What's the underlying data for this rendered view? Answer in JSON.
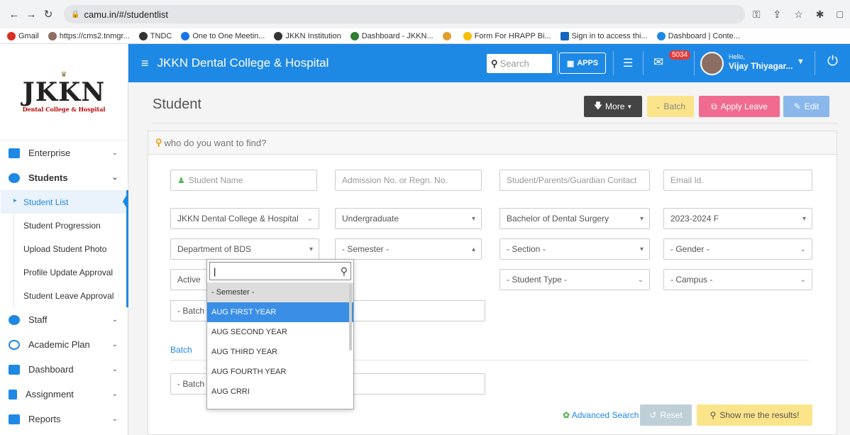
{
  "browser": {
    "url": "camu.in/#/studentlist",
    "bookmarks": [
      "Gmail",
      "https://cms2.tnmgr...",
      "TNDC",
      "One to One Meetin...",
      "JKKN Institution",
      "Dashboard - JKKN...",
      "Form For HRAPP Bi...",
      "Sign in to access thi...",
      "Dashboard | Conte..."
    ]
  },
  "logo": {
    "name": "JKKN",
    "sub": "Dental College & Hospital"
  },
  "sidebar": {
    "items": [
      {
        "label": "Enterprise",
        "color": "#1e88e5"
      },
      {
        "label": "Students",
        "color": "#1e88e5"
      },
      {
        "label": "Staff",
        "color": "#1e88e5"
      },
      {
        "label": "Academic Plan",
        "color": "#1e88e5"
      },
      {
        "label": "Dashboard",
        "color": "#1e88e5"
      },
      {
        "label": "Assignment",
        "color": "#1e88e5"
      },
      {
        "label": "Reports",
        "color": "#1e88e5"
      }
    ],
    "sub_items": [
      "Student List",
      "Student Progression",
      "Upload Student Photo",
      "Profile Update Approval",
      "Student Leave Approval"
    ]
  },
  "topbar": {
    "title": "JKKN Dental College & Hospital",
    "search_placeholder": "Search",
    "apps_label": "APPS",
    "mail_count": "5034",
    "hello": "Hello,",
    "user": "Vijay Thiyagar..."
  },
  "page": {
    "title": "Student",
    "more_label": "More",
    "batch_label": "Batch",
    "apply_leave_label": "Apply Leave",
    "edit_label": "Edit"
  },
  "search_panel": {
    "header": "who do you want to find?",
    "student_name": "Student Name",
    "admission": "Admission No. or Regn. No.",
    "contact": "Student/Parents/Guardian Contact",
    "email": "Email Id.",
    "institution": "JKKN Dental College & Hospital",
    "level": "Undergraduate",
    "program": "Bachelor of Dental Surgery",
    "academic_year": "2023-2024 F",
    "department": "Department of BDS",
    "semester": "- Semester -",
    "section": "- Section -",
    "gender": "- Gender -",
    "status": "Active",
    "student_type": "- Student Type -",
    "campus": "- Campus -",
    "batch_year": "- Batch Year -",
    "batch_section_label": "Batch",
    "batch_type": "- Batch type -",
    "advanced_search": "Advanced Search",
    "reset": "Reset",
    "show_results": "Show me the results!"
  },
  "semester_dropdown": {
    "options": [
      "- Semester -",
      "AUG FIRST YEAR",
      "AUG SECOND YEAR",
      "AUG THIRD YEAR",
      "AUG FOURTH YEAR",
      "AUG CRRI"
    ],
    "highlighted": "AUG FIRST YEAR"
  }
}
